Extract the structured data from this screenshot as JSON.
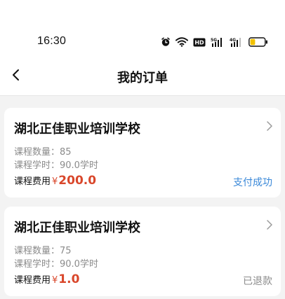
{
  "status_bar": {
    "time": "16:30",
    "icons": [
      "alarm-icon",
      "wifi-icon",
      "hd-icon",
      "5g-signal-icon",
      "4g-signal-icon",
      "battery-icon"
    ],
    "battery_level": 0.35,
    "battery_color": "#f2c200"
  },
  "nav": {
    "back_icon": "chevron-left-icon",
    "title": "我的订单"
  },
  "orders": [
    {
      "school": "湖北正佳职业培训学校",
      "count_label": "课程数量：85",
      "hours_label": "课程学时：90.0学时",
      "fee_label": "课程费用",
      "currency": "¥",
      "amount": "200.0",
      "status": "支付成功",
      "status_color": "#3a88d8"
    },
    {
      "school": "湖北正佳职业培训学校",
      "count_label": "课程数量：75",
      "hours_label": "课程学时：90.0学时",
      "fee_label": "课程费用",
      "currency": "¥",
      "amount": "1.0",
      "status": "已退款",
      "status_color": "#8b8b8b"
    }
  ],
  "colors": {
    "price": "#d9472b",
    "background": "#f3f3f3"
  }
}
